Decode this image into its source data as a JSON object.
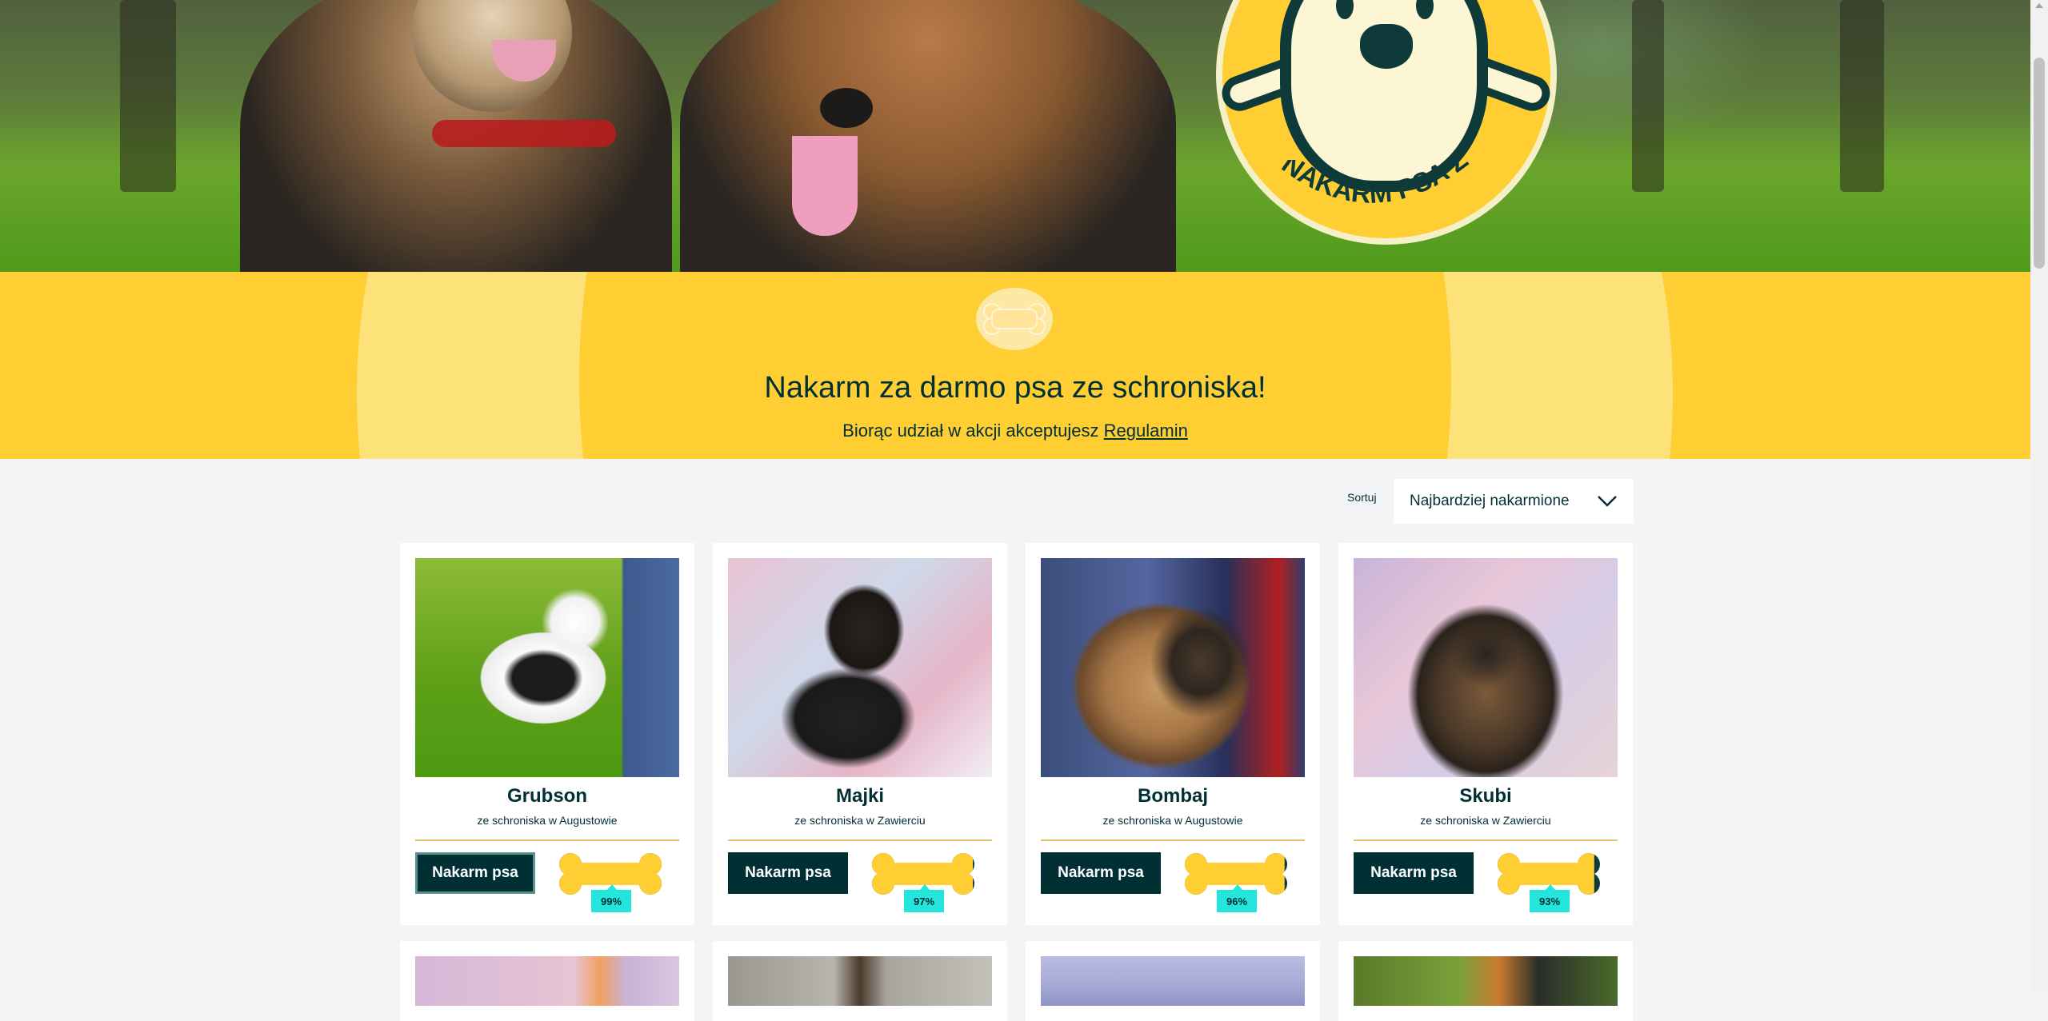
{
  "hero": {
    "logo_text": "NAKARM PSA Z OLX"
  },
  "band": {
    "title": "Nakarm za darmo psa ze schroniska!",
    "subtitle_prefix": "Biorąc udział w akcji akceptujesz ",
    "regulamin_link": "Regulamin"
  },
  "sort": {
    "label": "Sortuj",
    "selected": "Najbardziej nakarmione"
  },
  "dogs": [
    {
      "name": "Grubson",
      "shelter": "ze schroniska w Augustowie",
      "button": "Nakarm psa",
      "fed_percent": 99,
      "fed_label": "99%"
    },
    {
      "name": "Majki",
      "shelter": "ze schroniska w Zawierciu",
      "button": "Nakarm psa",
      "fed_percent": 97,
      "fed_label": "97%"
    },
    {
      "name": "Bombaj",
      "shelter": "ze schroniska w Augustowie",
      "button": "Nakarm psa",
      "fed_percent": 96,
      "fed_label": "96%"
    },
    {
      "name": "Skubi",
      "shelter": "ze schroniska w Zawierciu",
      "button": "Nakarm psa",
      "fed_percent": 93,
      "fed_label": "93%"
    }
  ],
  "colors": {
    "brand_yellow": "#ffce32",
    "light_yellow": "#fde279",
    "dark_teal": "#002f34",
    "accent_cyan": "#23e5db",
    "meter_empty": "#0e3a3a"
  }
}
